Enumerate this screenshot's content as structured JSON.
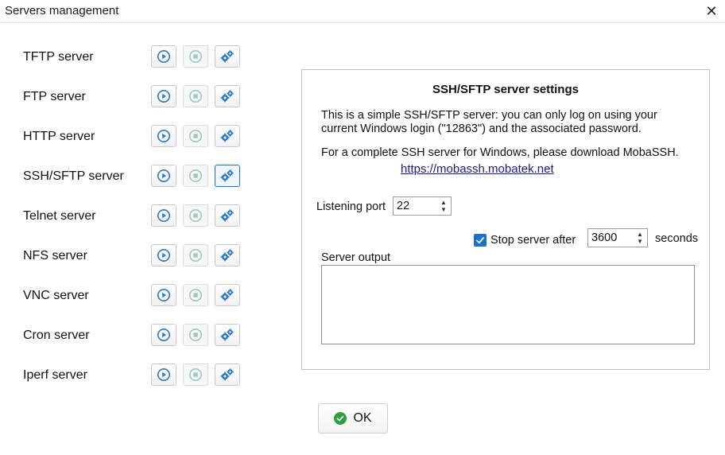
{
  "window": {
    "title": "Servers management",
    "close_glyph": "✕"
  },
  "servers": [
    {
      "label": "TFTP server"
    },
    {
      "label": "FTP server"
    },
    {
      "label": "HTTP server"
    },
    {
      "label": "SSH/SFTP server",
      "selected": true
    },
    {
      "label": "Telnet server"
    },
    {
      "label": "NFS server"
    },
    {
      "label": "VNC server"
    },
    {
      "label": "Cron server"
    },
    {
      "label": "Iperf server"
    }
  ],
  "icons": {
    "start": "play-circle-icon",
    "stop": "stop-circle-icon",
    "settings": "gears-icon"
  },
  "settings_panel": {
    "title": "SSH/SFTP server settings",
    "desc_line1": "This is a simple SSH/SFTP server: you can only log on using your",
    "desc_line2": "current Windows login (\"12863\") and the associated password.",
    "desc_line3": "For a complete SSH server for Windows, please download MobaSSH.",
    "link": "https://mobassh.mobatek.net",
    "listening_port_label": "Listening port",
    "listening_port_value": "22",
    "stop_after_label": "Stop server after",
    "stop_after_checked": true,
    "stop_after_value": "3600",
    "seconds_label": "seconds",
    "output_label": "Server output",
    "output_value": ""
  },
  "ok_button": {
    "label": "OK"
  },
  "colors": {
    "accent": "#1e6fc8",
    "start_icon": "#2b79c2",
    "stop_icon": "#9fc9c0",
    "ok_green": "#2ea043",
    "link": "#1a1a8a"
  }
}
